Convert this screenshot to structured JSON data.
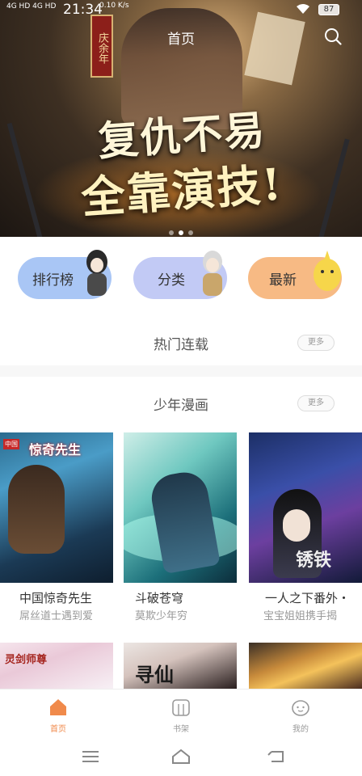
{
  "status_bar": {
    "signal": "4G HD 4G HD",
    "time": "21:34",
    "speed": "0.10 K/s",
    "battery": "87"
  },
  "header": {
    "title": "首页"
  },
  "banner": {
    "seal_text": "庆余年",
    "slogan_line1": "复仇不易",
    "slogan_line2": "全靠演技!",
    "page_count": 3,
    "active_page": 1
  },
  "categories": [
    {
      "label": "排行榜",
      "color": "#a9c6f5"
    },
    {
      "label": "分类",
      "color": "#c2caf5"
    },
    {
      "label": "最新",
      "color": "#f7ba84"
    }
  ],
  "sections": {
    "hot": {
      "title": "热门连载",
      "more": "更多"
    },
    "shonen": {
      "title": "少年漫画",
      "more": "更多"
    }
  },
  "comics": [
    {
      "title": "中国惊奇先生",
      "desc": "屌丝道士遇到爱",
      "cover_tag": "中国",
      "cover_title": "惊奇先生"
    },
    {
      "title": "斗破苍穹",
      "desc": "莫欺少年穷",
      "cover_title": ""
    },
    {
      "title": "一人之下番外・",
      "desc": "宝宝姐姐携手揭",
      "cover_title": "锈铁"
    },
    {
      "title": "",
      "desc": "",
      "cover_title": "灵剑师尊"
    },
    {
      "title": "",
      "desc": "",
      "cover_title": "寻仙"
    },
    {
      "title": "",
      "desc": "",
      "cover_title": ""
    }
  ],
  "bottom_nav": [
    {
      "label": "首页",
      "icon": "home-icon",
      "active": true
    },
    {
      "label": "书架",
      "icon": "bookshelf-icon",
      "active": false
    },
    {
      "label": "我的",
      "icon": "profile-icon",
      "active": false
    }
  ],
  "colors": {
    "accent": "#f08a4b",
    "nav_inactive": "#999999"
  }
}
